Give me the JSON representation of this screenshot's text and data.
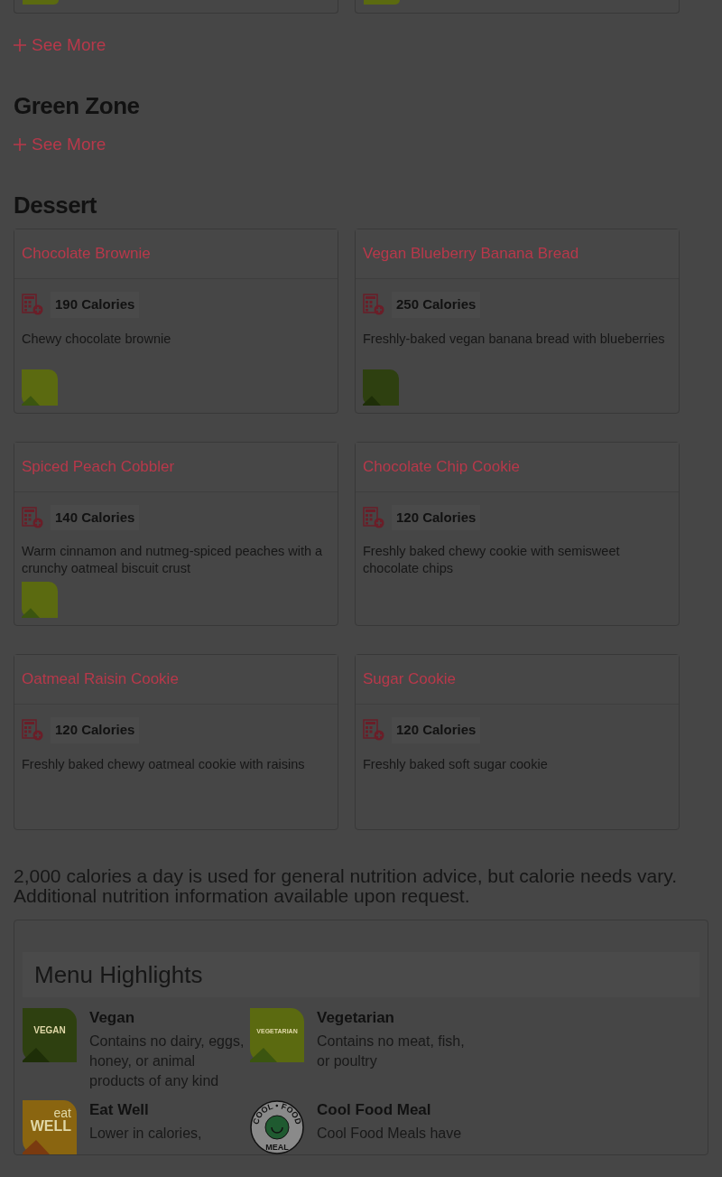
{
  "previous_section": {
    "cards": [
      {
        "kind": "vegetarian"
      },
      {
        "kind": "vegetarian"
      }
    ],
    "see_more": "See More"
  },
  "sections": [
    {
      "title": "Green Zone",
      "see_more": "See More"
    },
    {
      "title": "Dessert",
      "cards": [
        {
          "name": "Chocolate Brownie",
          "calories": "190 Calories",
          "description": "Chewy chocolate brownie",
          "kind": "vegetarian"
        },
        {
          "name": "Vegan Blueberry Banana Bread",
          "calories": "250 Calories",
          "description": "Freshly-baked vegan banana bread with blueberries",
          "kind": "vegan"
        },
        {
          "name": "Spiced Peach Cobbler",
          "calories": "140 Calories",
          "description": "Warm cinnamon and nutmeg-spiced peaches with a crunchy oatmeal biscuit crust",
          "kind": "vegetarian"
        },
        {
          "name": "Chocolate Chip Cookie",
          "calories": "120 Calories",
          "description": "Freshly baked chewy cookie with semisweet chocolate chips"
        },
        {
          "name": "Oatmeal Raisin Cookie",
          "calories": "120 Calories",
          "description": "Freshly baked chewy oatmeal cookie with raisins"
        },
        {
          "name": "Sugar Cookie",
          "calories": "120 Calories",
          "description": "Freshly baked soft sugar cookie"
        }
      ]
    }
  ],
  "footnote": "2,000 calories a day is used for general nutrition advice, but calorie needs vary. Additional nutrition information available upon request.",
  "highlights": {
    "title": "Menu Highlights",
    "items": [
      {
        "kind": "vegan",
        "badge_text": [
          "VEGAN"
        ],
        "title": "Vegan",
        "description": "Contains no dairy, eggs, honey, or animal products of any kind"
      },
      {
        "kind": "vegetarian",
        "badge_text": [
          "VEGETARIAN"
        ],
        "title": "Vegetarian",
        "description": "Contains no meat, fish, or poultry"
      },
      {
        "kind": "eatwell",
        "badge_text": [
          "eat",
          "WELL"
        ],
        "title": "Eat Well",
        "description": "Lower in calories,"
      },
      {
        "kind": "coolfood",
        "badge_text": [
          "COOL • FOOD",
          "MEAL"
        ],
        "title": "Cool Food Meal",
        "description": "Cool Food Meals have"
      }
    ]
  }
}
